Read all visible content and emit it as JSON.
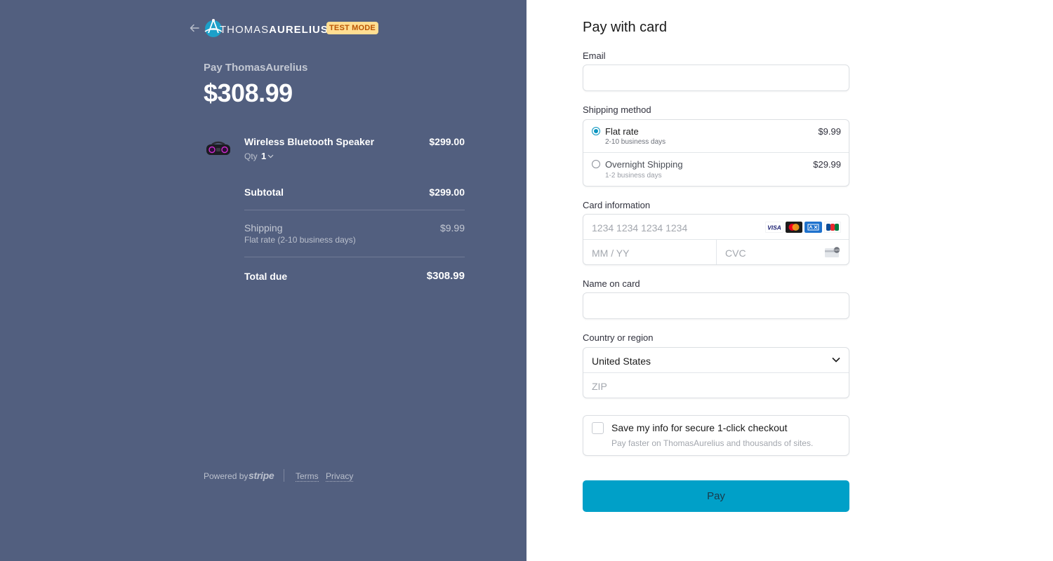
{
  "merchant": {
    "brand_thin": "THOMAS",
    "brand_bold": "AURELIUS",
    "badge": "TEST MODE",
    "pay_to": "Pay ThomasAurelius",
    "total": "$308.99"
  },
  "order": {
    "item": {
      "name": "Wireless Bluetooth Speaker",
      "price": "$299.00",
      "qty_label": "Qty",
      "qty": "1"
    },
    "subtotal_label": "Subtotal",
    "subtotal": "$299.00",
    "shipping_label": "Shipping",
    "shipping_detail": "Flat rate (2-10 business days)",
    "shipping": "$9.99",
    "total_label": "Total due",
    "total": "$308.99"
  },
  "footer": {
    "powered": "Powered by",
    "stripe": "stripe",
    "terms": "Terms",
    "privacy": "Privacy"
  },
  "form": {
    "heading": "Pay with card",
    "email_label": "Email",
    "shipping_label": "Shipping method",
    "shipping_options": [
      {
        "title": "Flat rate",
        "sub": "2-10 business days",
        "price": "$9.99",
        "selected": true
      },
      {
        "title": "Overnight Shipping",
        "sub": "1-2 business days",
        "price": "$29.99",
        "selected": false
      }
    ],
    "card_label": "Card information",
    "card_number_placeholder": "1234 1234 1234 1234",
    "expiry_placeholder": "MM / YY",
    "cvc_placeholder": "CVC",
    "card_brands": [
      "VISA",
      "mastercard",
      "amex",
      "JCB"
    ],
    "name_label": "Name on card",
    "country_label": "Country or region",
    "country": "United States",
    "zip_placeholder": "ZIP",
    "save_title": "Save my info for secure 1-click checkout",
    "save_sub": "Pay faster on ThomasAurelius and thousands of sites.",
    "pay_button": "Pay"
  },
  "colors": {
    "left_bg": "#525f7f",
    "accent": "#00a0c8",
    "badge_bg": "#ffde92"
  }
}
